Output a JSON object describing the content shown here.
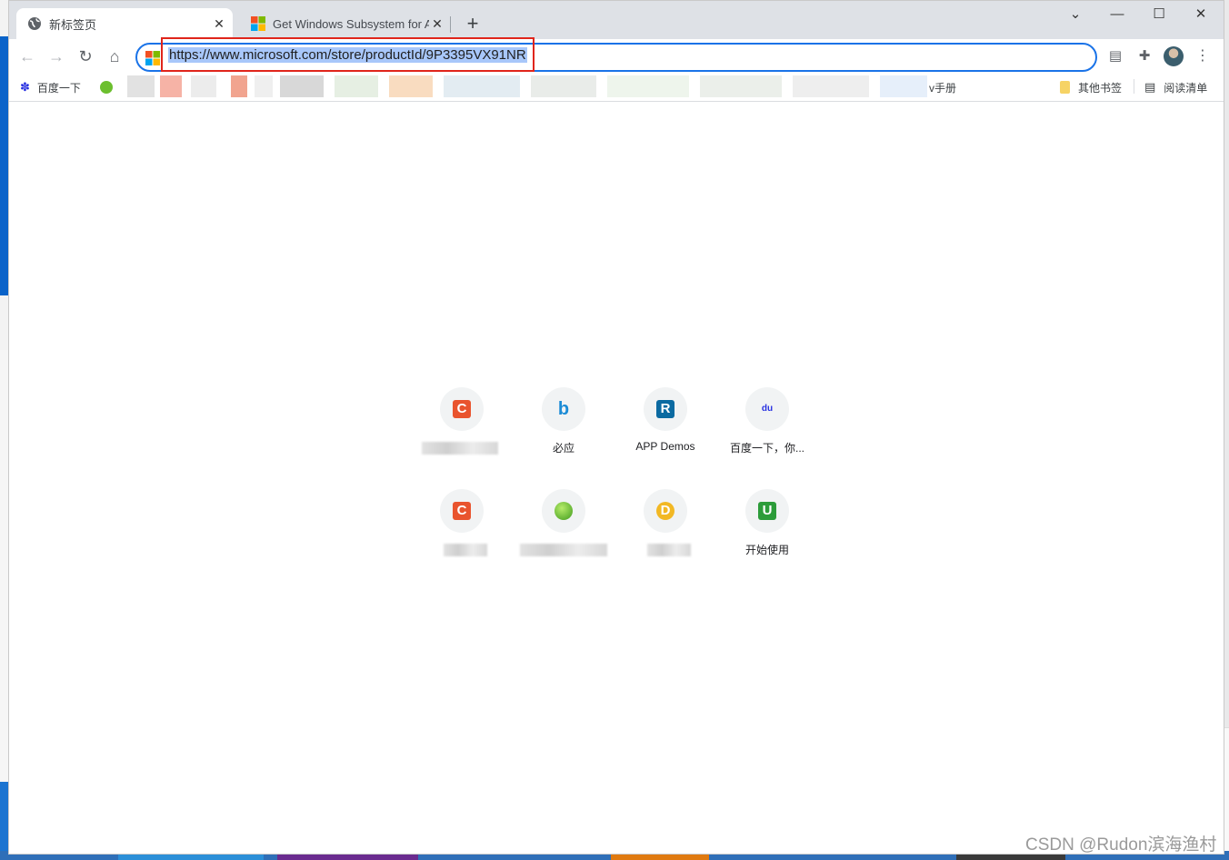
{
  "browser": {
    "tabs": [
      {
        "title": "新标签页",
        "active": true
      },
      {
        "title": "Get Windows Subsystem for A",
        "active": false
      }
    ],
    "window_controls": {
      "minimize": "—",
      "maximize": "☐",
      "close": "✕",
      "tab_search": "⌄"
    },
    "address_bar": {
      "url": "https://www.microsoft.com/store/productId/9P3395VX91NR"
    },
    "bookmarks": [
      {
        "label": "百度一下"
      },
      {
        "label": "v手册"
      },
      {
        "label": "其他书签"
      },
      {
        "label": "阅读清单"
      }
    ]
  },
  "shortcuts": [
    {
      "label": "",
      "icon": "csdn-icon",
      "color": "#e9542e",
      "glyph": "C"
    },
    {
      "label": "必应",
      "icon": "bing-icon",
      "color": "#1c8cd6",
      "glyph": "b"
    },
    {
      "label": "APP Demos",
      "icon": "r-icon",
      "color": "#0b6aa1",
      "glyph": "R"
    },
    {
      "label": "百度一下，你...",
      "icon": "baidu-paw-icon",
      "color": "#2932e1",
      "glyph": "du"
    },
    {
      "label": "",
      "icon": "csdn-icon",
      "color": "#e9542e",
      "glyph": "C"
    },
    {
      "label": "",
      "icon": "green-ball-icon",
      "color": "#5cb82b",
      "glyph": ""
    },
    {
      "label": "",
      "icon": "d-coin-icon",
      "color": "#f2b824",
      "glyph": "D"
    },
    {
      "label": "开始使用",
      "icon": "u-icon",
      "color": "#2c9c3a",
      "glyph": "U"
    }
  ],
  "watermark": "CSDN @Rudon滨海渔村"
}
